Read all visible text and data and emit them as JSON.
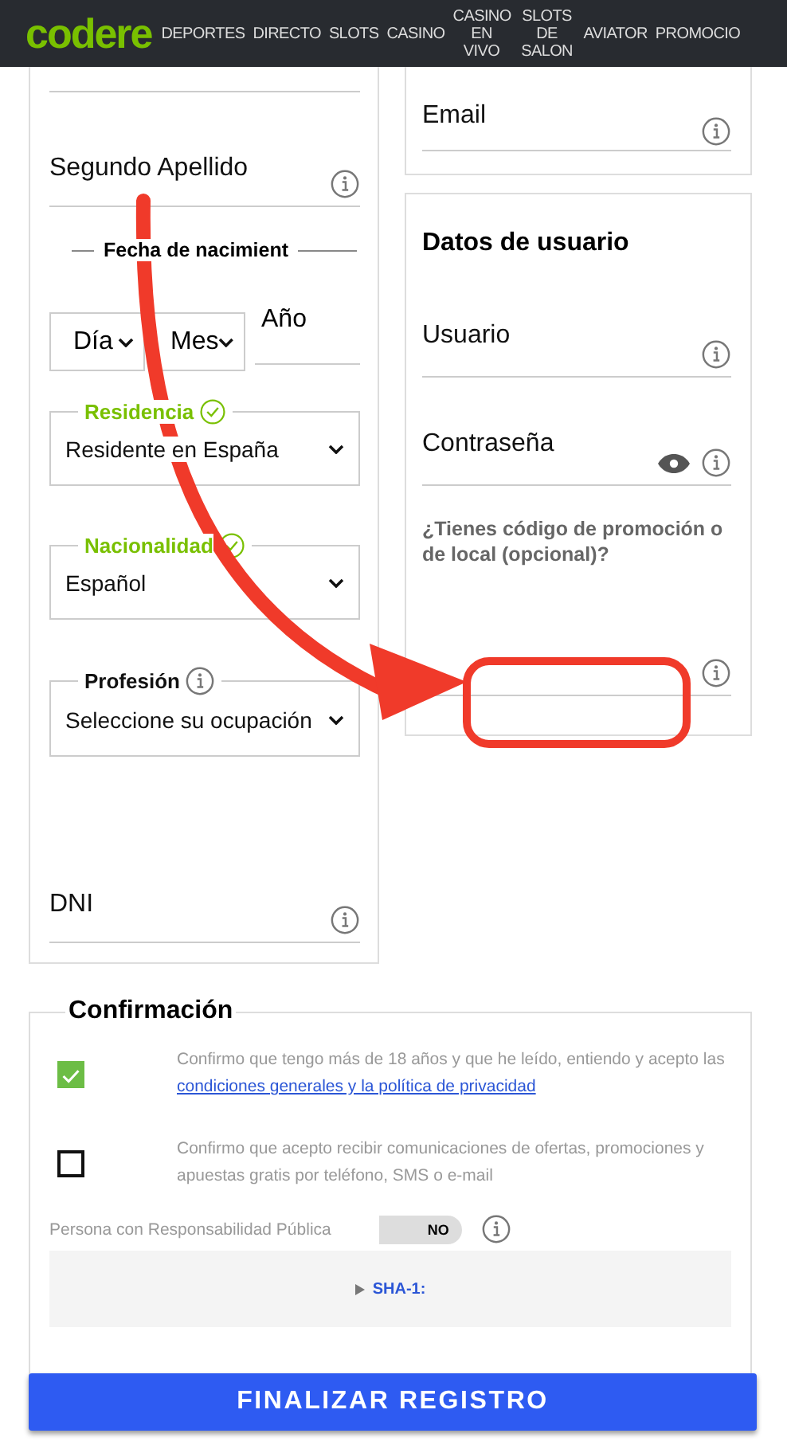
{
  "header": {
    "logo": "codere",
    "nav": [
      {
        "label": "DEPORTES"
      },
      {
        "label": "DIRECTO"
      },
      {
        "label": "SLOTS"
      },
      {
        "label": "CASINO"
      },
      {
        "label": "CASINO EN VIVO"
      },
      {
        "label": "SLOTS DE SALON"
      },
      {
        "label": "AVIATOR"
      },
      {
        "label": "PROMOCIO"
      }
    ]
  },
  "personal": {
    "second_surname": {
      "label": "Segundo Apellido"
    },
    "birth_date": {
      "legend": "Fecha de nacimient",
      "day": "Día",
      "month": "Mes",
      "year": "Año"
    },
    "selects": [
      {
        "legend": "Residencia",
        "valid": true,
        "value": "Residente en España"
      },
      {
        "legend": "Nacionalidad",
        "valid": true,
        "value": "Español"
      },
      {
        "legend": "Profesión",
        "valid": false,
        "value": "Seleccione su ocupación"
      }
    ],
    "id_number": {
      "label": "DNI"
    }
  },
  "contact": {
    "email": {
      "label": "Email"
    }
  },
  "user_data": {
    "title": "Datos de usuario",
    "fields": [
      {
        "kind": "text",
        "label": "Usuario"
      },
      {
        "kind": "password",
        "label": "Contraseña"
      }
    ],
    "promo": {
      "label": "¿Tienes código de promoción o de local (opcional)?"
    }
  },
  "confirmation": {
    "title": "Confirmación",
    "checks": [
      {
        "checked": true,
        "text": "Confirmo que tengo más de 18 años y que he leído, entiendo y acepto las ",
        "link": "condiciones generales y la política de privacidad"
      },
      {
        "checked": false,
        "text": "Confirmo que acepto recibir comunicaciones de ofertas, promociones y apuestas gratis por teléfono, SMS o e-mail"
      }
    ],
    "public_person": {
      "label": "Persona con Responsabilidad Pública",
      "on": false,
      "state_label": "NO"
    },
    "sha": {
      "label": "SHA-1:",
      "expanded": false
    }
  },
  "submit": {
    "label": "FINALIZAR REGISTRO"
  }
}
